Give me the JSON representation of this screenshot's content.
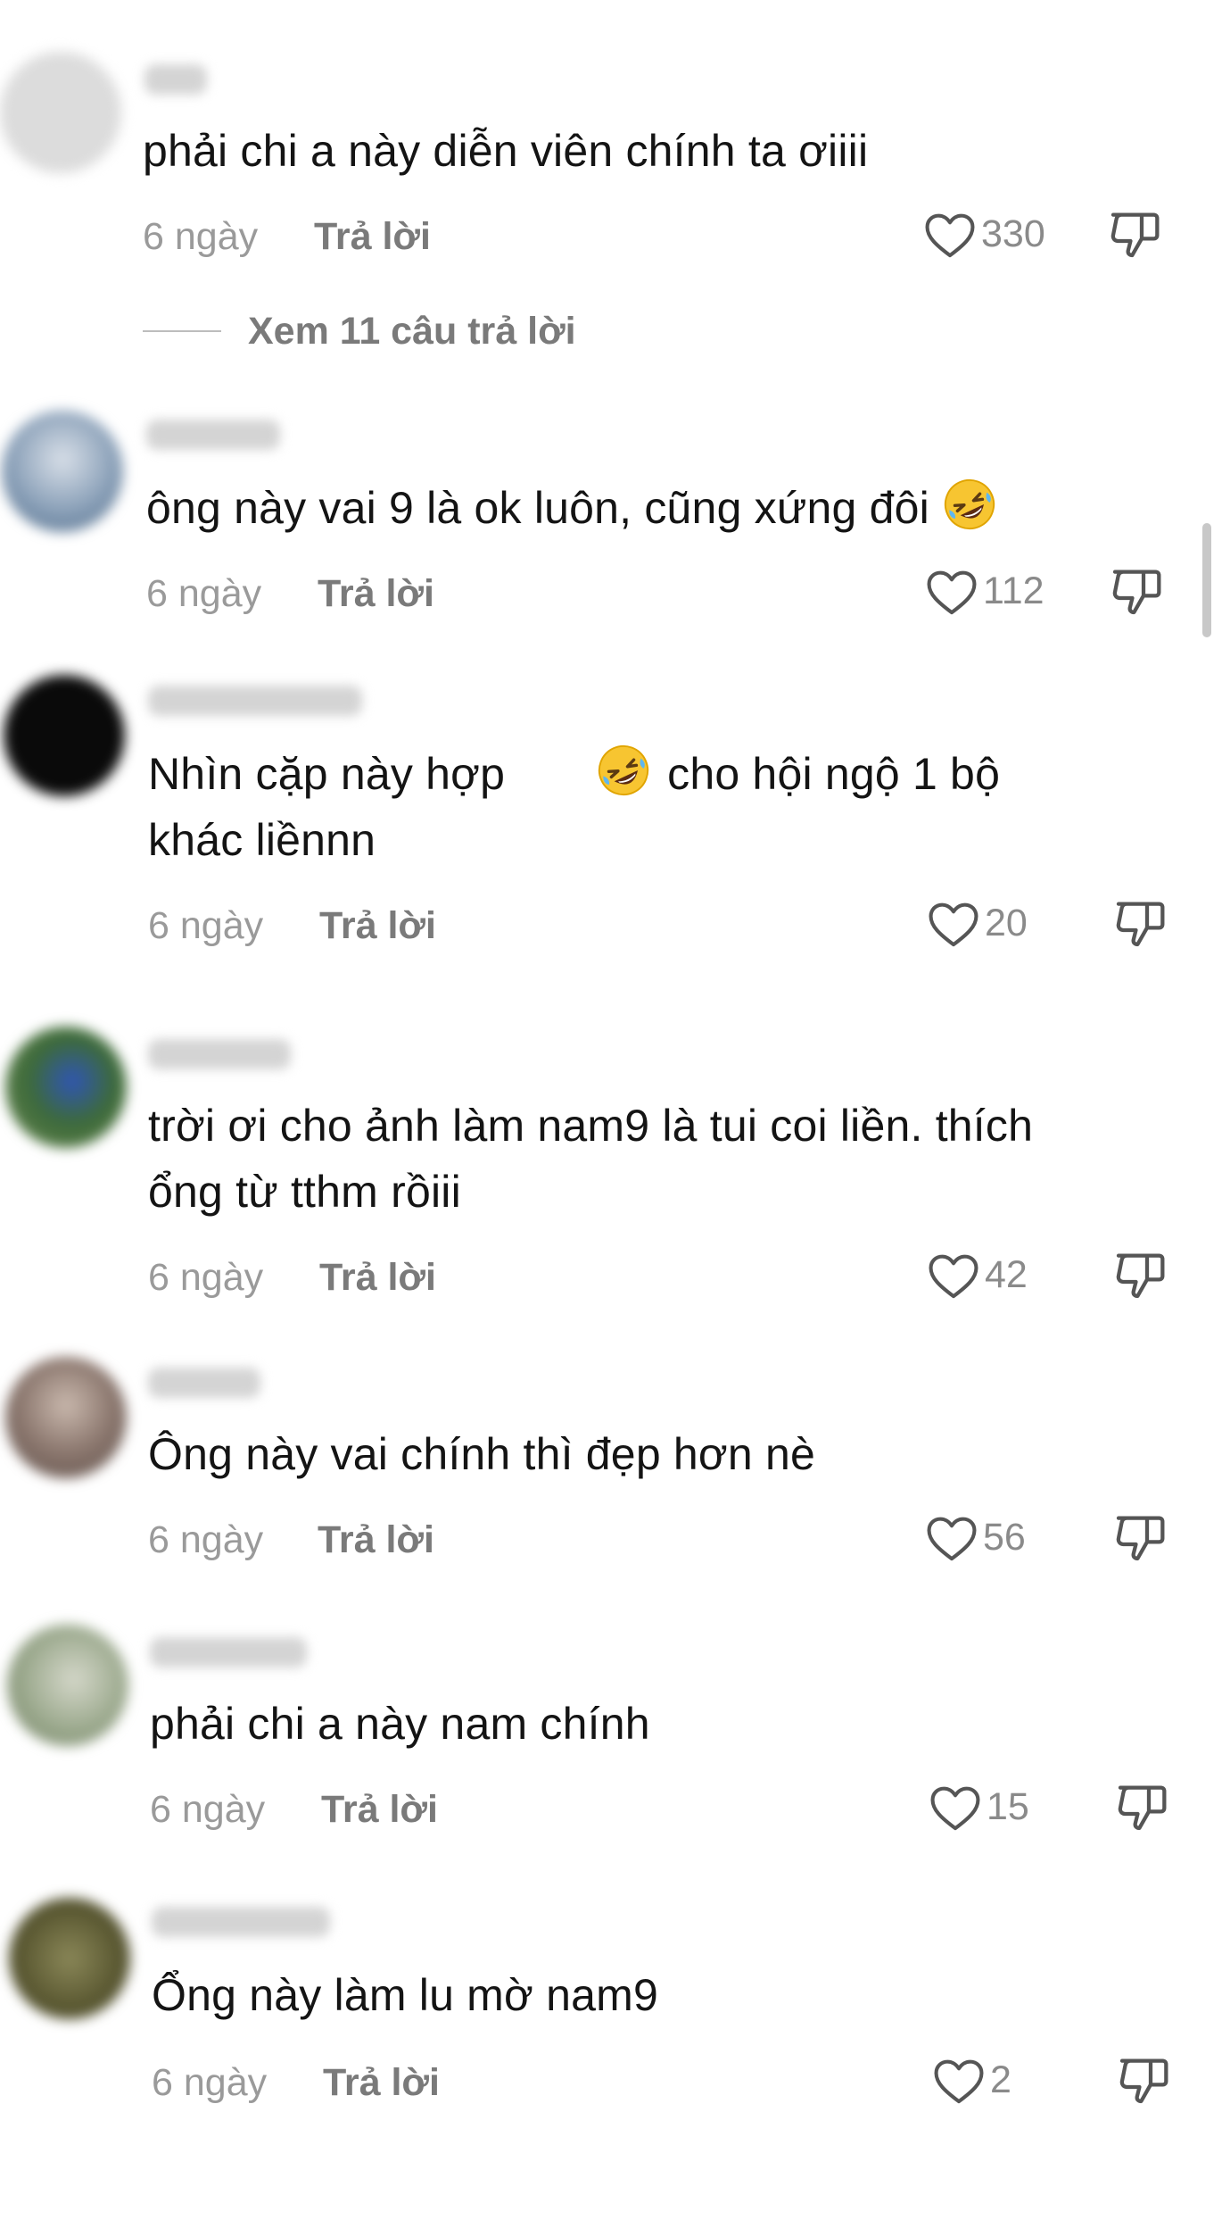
{
  "colors": {
    "background": "#ffffff",
    "text": "#141414",
    "meta_text": "#9a9a9a",
    "reply_text": "#7a7a7a",
    "icon": "#555555"
  },
  "view_replies": "Xem 11 câu trả lời",
  "comments": [
    {
      "avatar_color": "#dcdcdc",
      "text": "phải chi a này diễn viên chính ta ơiiii",
      "time": "6 ngày",
      "reply": "Trả lời",
      "likes": "330",
      "emoji": ""
    },
    {
      "avatar_color": "#6f8aa5",
      "text": "ông này vai 9 là ok luôn, cũng xứng đôi",
      "time": "6 ngày",
      "reply": "Trả lời",
      "likes": "112",
      "emoji": "rofl-emoji"
    },
    {
      "avatar_color": "#0a0a0a",
      "text": "Nhìn cặp này hợp",
      "text_after_emoji": "cho hội ngộ 1 bộ",
      "text_line2": "khác liềnnn",
      "time": "6 ngày",
      "reply": "Trả lời",
      "likes": "20",
      "emoji": "rofl-emoji"
    },
    {
      "avatar_color": "#4d6b3a",
      "text": "trời ơi cho ảnh làm nam9 là tui coi liền. thích",
      "text_line2": "ổng từ tthm rồiii",
      "time": "6 ngày",
      "reply": "Trả lời",
      "likes": "42",
      "emoji": ""
    },
    {
      "avatar_color": "#7a6b64",
      "text": "Ông này vai chính thì đẹp hơn nè",
      "time": "6 ngày",
      "reply": "Trả lời",
      "likes": "56",
      "emoji": ""
    },
    {
      "avatar_color": "#9aa88c",
      "text": "phải chi a này nam chính",
      "time": "6 ngày",
      "reply": "Trả lời",
      "likes": "15",
      "emoji": ""
    },
    {
      "avatar_color": "#5c5a33",
      "text": "Ổng này làm lu mờ nam9",
      "time": "6 ngày",
      "reply": "Trả lời",
      "likes": "2",
      "emoji": ""
    }
  ]
}
